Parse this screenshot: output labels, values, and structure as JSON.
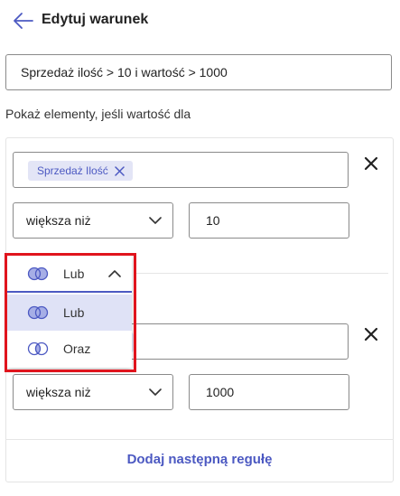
{
  "header": {
    "title": "Edytuj warunek",
    "back_icon": "arrow-left-icon"
  },
  "condition_name": {
    "value": "Sprzedaż ilość > 10 i wartość > 1000",
    "placeholder": ""
  },
  "hint": "Pokaż elementy, jeśli wartość dla",
  "rules": [
    {
      "field_tag": "Sprzedaż Ilość",
      "comparator": "większa niż",
      "value": "10"
    },
    {
      "field_tag": "",
      "comparator": "większa niż",
      "value": "1000"
    }
  ],
  "operator_dropdown": {
    "current": "Lub",
    "options": [
      {
        "label": "Lub",
        "selected": true,
        "icon": "venn-or-icon"
      },
      {
        "label": "Oraz",
        "selected": false,
        "icon": "venn-and-icon"
      }
    ]
  },
  "add_rule_label": "Dodaj następną regułę",
  "colors": {
    "accent": "#4c59c2",
    "tag_bg": "#e3e5f6",
    "selected_bg": "#dfe2f6",
    "highlight": "#e0141d",
    "border": "#8a8a8a"
  }
}
